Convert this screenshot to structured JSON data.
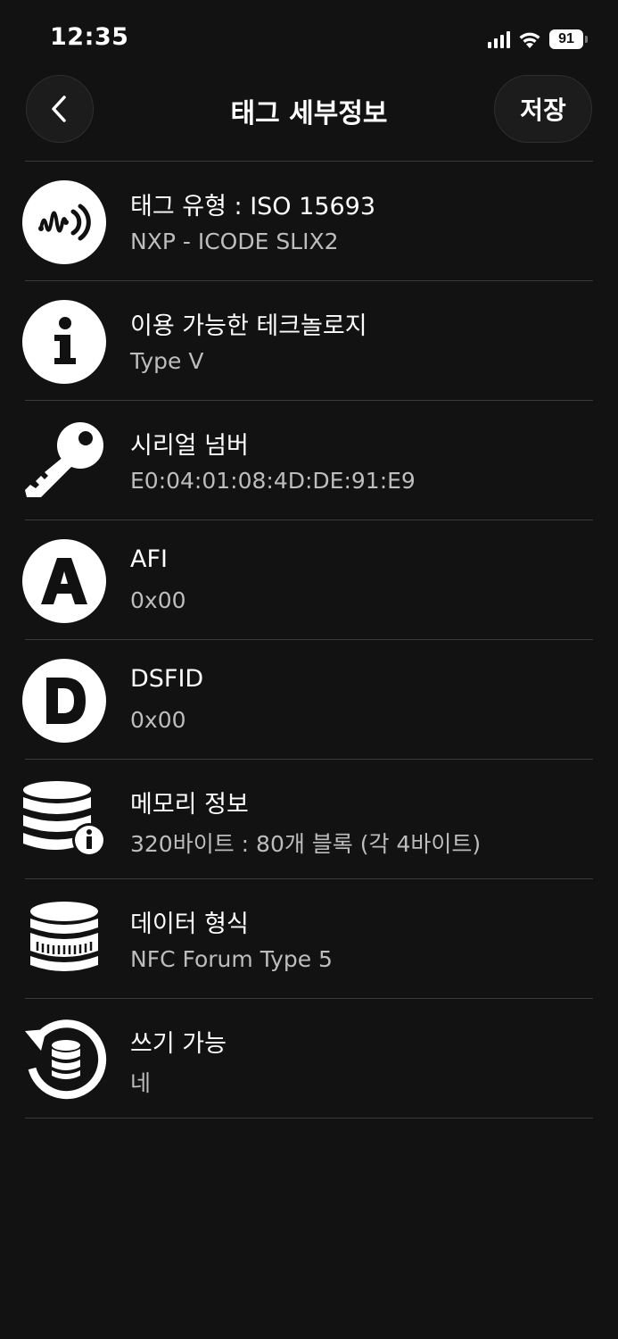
{
  "status_bar": {
    "time": "12:35",
    "battery": "91"
  },
  "header": {
    "title": "태그 세부정보",
    "save_label": "저장"
  },
  "rows": [
    {
      "icon": "nfc-wave-icon",
      "title": "태그 유형 : ISO 15693",
      "value": "NXP - ICODE SLIX2"
    },
    {
      "icon": "info-icon",
      "title": "이용 가능한 테크놀로지",
      "value": "Type V"
    },
    {
      "icon": "key-icon",
      "title": "시리얼 넘버",
      "value": "E0:04:01:08:4D:DE:91:E9"
    },
    {
      "icon": "letter-a-icon",
      "title": "AFI",
      "value": "0x00"
    },
    {
      "icon": "letter-d-icon",
      "title": "DSFID",
      "value": "0x00"
    },
    {
      "icon": "database-info-icon",
      "title": "메모리 정보",
      "value": "320바이트 : 80개 블록 (각 4바이트)"
    },
    {
      "icon": "data-format-icon",
      "title": "데이터 형식",
      "value": "NFC Forum Type 5"
    },
    {
      "icon": "writable-database-icon",
      "title": "쓰기 가능",
      "value": "네"
    }
  ]
}
